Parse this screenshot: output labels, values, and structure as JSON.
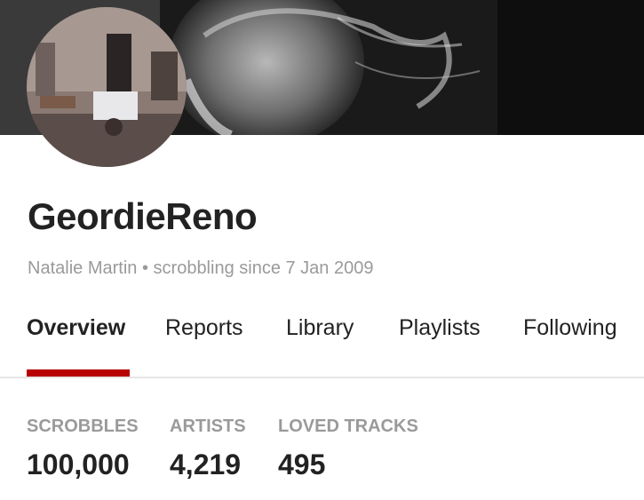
{
  "profile": {
    "username": "GeordieReno",
    "real_name": "Natalie Martin",
    "separator": "•",
    "scrobbling_since": "scrobbling since 7 Jan 2009"
  },
  "tabs": [
    {
      "label": "Overview",
      "active": true
    },
    {
      "label": "Reports",
      "active": false
    },
    {
      "label": "Library",
      "active": false
    },
    {
      "label": "Playlists",
      "active": false
    },
    {
      "label": "Following",
      "active": false
    }
  ],
  "stats": [
    {
      "label": "SCROBBLES",
      "value": "100,000"
    },
    {
      "label": "ARTISTS",
      "value": "4,219"
    },
    {
      "label": "LOVED TRACKS",
      "value": "495"
    }
  ],
  "colors": {
    "accent": "#b90000",
    "text_primary": "#222222",
    "text_muted": "#9a9a9a"
  }
}
